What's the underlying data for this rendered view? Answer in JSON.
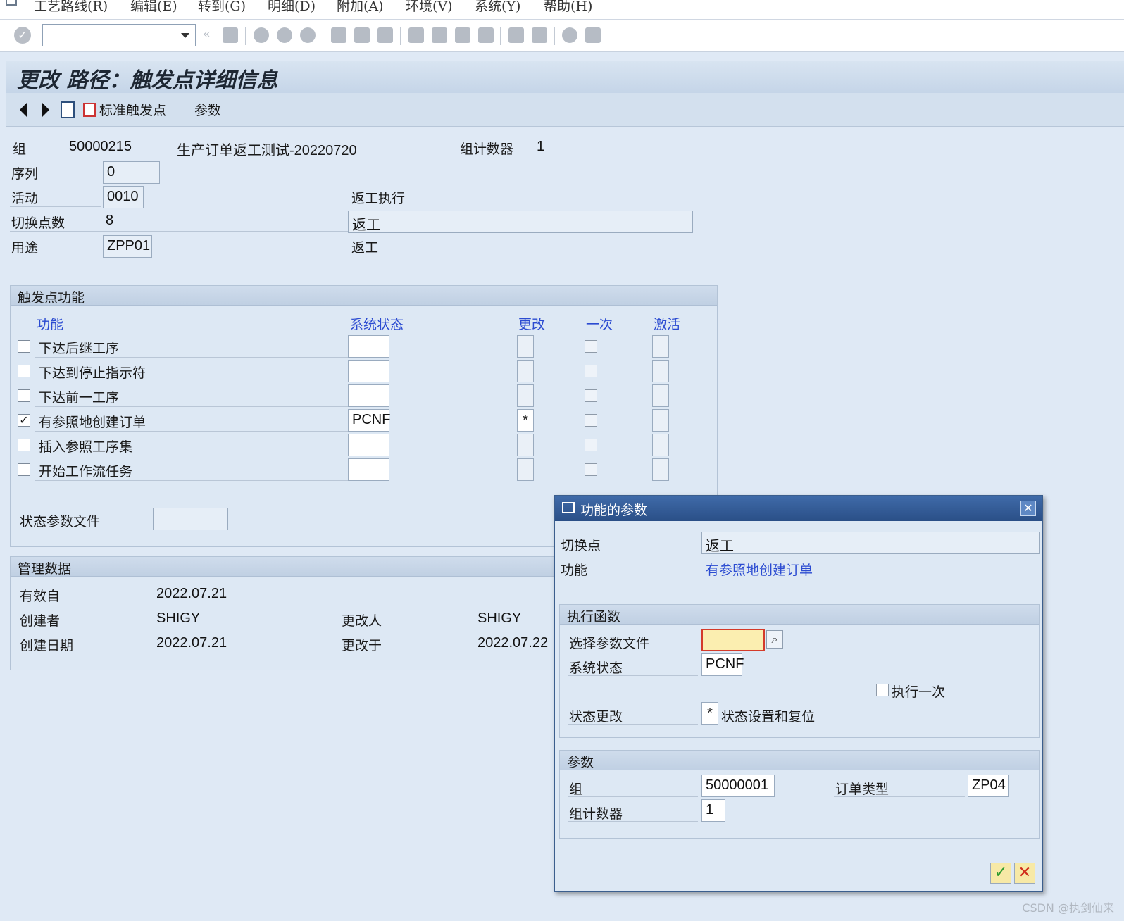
{
  "menu": [
    "工艺路线(R)",
    "编辑(E)",
    "转到(G)",
    "明细(D)",
    "附加(A)",
    "环境(V)",
    "系统(Y)",
    "帮助(H)"
  ],
  "toolbar": {
    "command_field": ""
  },
  "title": "更改 路径：触发点详细信息",
  "app_toolbar": {
    "standard_trigger": "标准触发点",
    "params": "参数"
  },
  "header": {
    "group_label": "组",
    "group_value": "50000215",
    "group_desc": "生产订单返工测试-20220720",
    "counter_label": "组计数器",
    "counter_value": "1",
    "seq_label": "序列",
    "seq_value": "0",
    "activity_label": "活动",
    "activity_value": "0010",
    "activity_desc": "返工执行",
    "switch_label": "切换点数",
    "switch_value": "8",
    "switch_desc": "返工",
    "usage_label": "用途",
    "usage_value": "ZPP01",
    "usage_desc": "返工"
  },
  "trigger_group": {
    "title": "触发点功能",
    "col_function": "功能",
    "col_status": "系统状态",
    "col_change": "更改",
    "col_once": "一次",
    "col_active": "激活",
    "rows": [
      {
        "label": "下达后继工序",
        "checked": "",
        "status": "",
        "change": ""
      },
      {
        "label": "下达到停止指示符",
        "checked": "",
        "status": "",
        "change": ""
      },
      {
        "label": "下达前一工序",
        "checked": "",
        "status": "",
        "change": ""
      },
      {
        "label": "有参照地创建订单",
        "checked": "✓",
        "status": "PCNF",
        "change": "*"
      },
      {
        "label": "插入参照工序集",
        "checked": "",
        "status": "",
        "change": ""
      },
      {
        "label": "开始工作流任务",
        "checked": "",
        "status": "",
        "change": ""
      }
    ],
    "status_profile_label": "状态参数文件",
    "status_profile_value": ""
  },
  "admin_group": {
    "title": "管理数据",
    "valid_from_label": "有效自",
    "valid_from": "2022.07.21",
    "created_by_label": "创建者",
    "created_by": "SHIGY",
    "changed_by_label": "更改人",
    "changed_by": "SHIGY",
    "created_on_label": "创建日期",
    "created_on": "2022.07.21",
    "changed_on_label": "更改于",
    "changed_on": "2022.07.22"
  },
  "dialog": {
    "title": "功能的参数",
    "switch_label": "切换点",
    "switch_value": "返工",
    "function_label": "功能",
    "function_value": "有参照地创建订单",
    "exec_title": "执行函数",
    "select_profile_label": "选择参数文件",
    "select_profile_value": "",
    "sys_status_label": "系统状态",
    "sys_status_value": "PCNF",
    "exec_once_label": "执行一次",
    "status_change_label": "状态更改",
    "status_change_value": "*",
    "status_change_desc": "状态设置和复位",
    "params_title": "参数",
    "group_label": "组",
    "group_value": "50000001",
    "order_type_label": "订单类型",
    "order_type_value": "ZP04",
    "counter_label": "组计数器",
    "counter_value": "1"
  },
  "watermark": "CSDN @执剑仙来"
}
